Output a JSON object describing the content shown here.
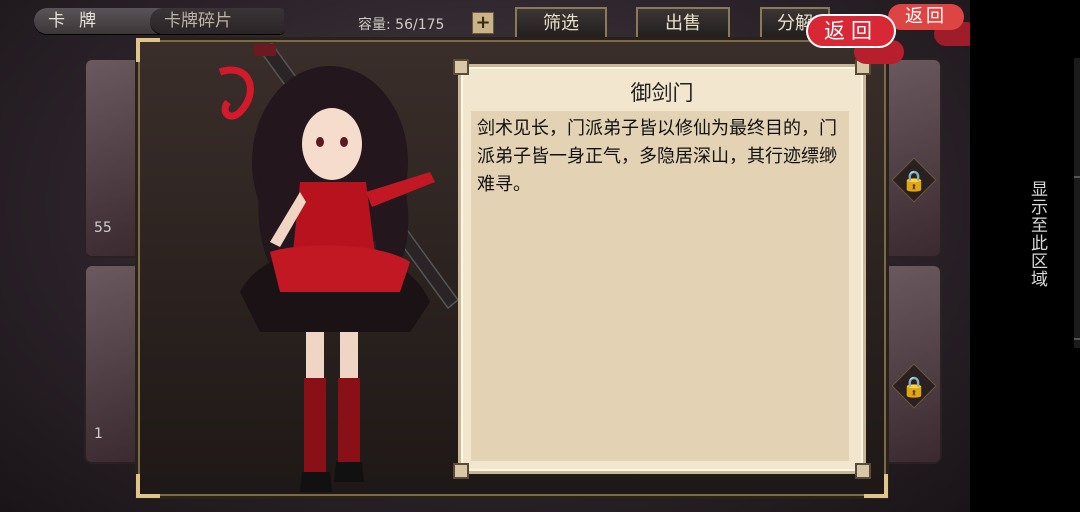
{
  "top_bar": {
    "tab_cards": "卡牌",
    "tab_shards": "卡牌碎片",
    "capacity_label": "容量:",
    "capacity_value": "56/175",
    "add_icon": "plus-icon",
    "filter_label": "筛选",
    "sell_label": "出售",
    "decompose_label": "分解",
    "back_label": "返回"
  },
  "background_cards": [
    {
      "level": "55"
    },
    {
      "level": "1"
    }
  ],
  "dialog": {
    "title": "御剑门",
    "description": "剑术见长，门派弟子皆以修仙为最终目的，门派弟子皆一身正气，多隐居深山，其行迹缥缈难寻。",
    "back_label": "返回"
  },
  "system": {
    "display_cutout_label": "显示至此区域"
  },
  "colors": {
    "accent_red": "#d82836",
    "panel_paper": "#f2e6cf",
    "frame_gold": "#e0c58a"
  }
}
